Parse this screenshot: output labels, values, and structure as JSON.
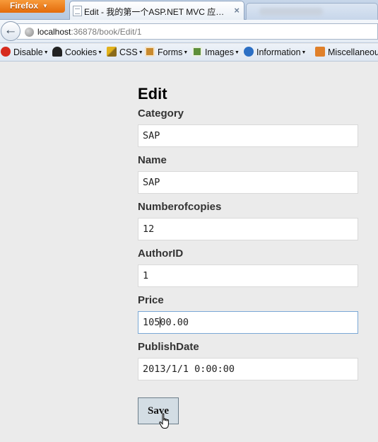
{
  "browser": {
    "menu_label": "Firefox",
    "active_tab_title": "Edit - 我的第一个ASP.NET MVC 应…",
    "close_glyph": "×",
    "url_host": "localhost",
    "url_path": ":36878/book/Edit/1"
  },
  "toolbar": {
    "items": [
      {
        "label": "Disable",
        "icon": "disable-icon",
        "color": "#d62b1e"
      },
      {
        "label": "Cookies",
        "icon": "cookies-icon",
        "color": "#222222"
      },
      {
        "label": "CSS",
        "icon": "css-icon",
        "color": "#e2b21b"
      },
      {
        "label": "Forms",
        "icon": "forms-icon",
        "color": "#c98a2e"
      },
      {
        "label": "Images",
        "icon": "images-icon",
        "color": "#5d8f3a"
      },
      {
        "label": "Information",
        "icon": "information-icon",
        "color": "#2c6fc4"
      },
      {
        "label": "Miscellaneous",
        "icon": "miscellaneous-icon",
        "color": "#e0802a"
      }
    ]
  },
  "page": {
    "title": "Edit",
    "fields": [
      {
        "label": "Category",
        "value": "SAP"
      },
      {
        "label": "Name",
        "value": "SAP"
      },
      {
        "label": "Numberofcopies",
        "value": "12"
      },
      {
        "label": "AuthorID",
        "value": "1"
      },
      {
        "label": "Price",
        "value_before_caret": "105",
        "value_after_caret": "00.00"
      },
      {
        "label": "PublishDate",
        "value": "2013/1/1 0:00:00"
      }
    ],
    "save_label": "Save"
  },
  "colors": {
    "page_background": "#ebebeb",
    "focus_border": "#7aa8d6",
    "firefox_orange": "#e36b0b"
  }
}
